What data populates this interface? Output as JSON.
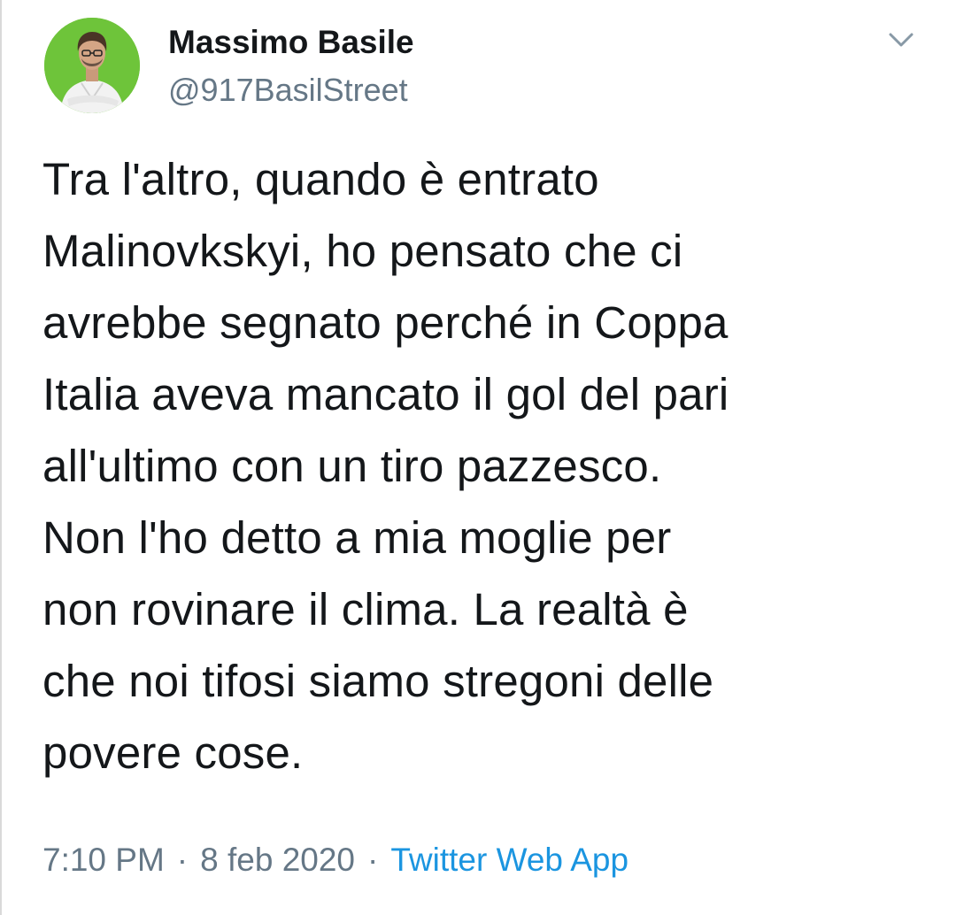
{
  "tweet": {
    "author": {
      "display_name": "Massimo Basile",
      "handle": "@917BasilStreet"
    },
    "text": "Tra l'altro, quando è entrato\nMalinovkskyi, ho pensato che ci\navrebbe segnato perché in Coppa\nItalia aveva mancato il gol del pari\nall'ultimo con un tiro pazzesco.\nNon l'ho detto a mia moglie per\nnon rovinare il clima. La realtà è\nche noi tifosi siamo stregoni delle\npovere cose.",
    "time": "7:10 PM",
    "date": "8 feb 2020",
    "separator": "·",
    "source": "Twitter Web App"
  },
  "icons": {
    "avatar": "profile-photo",
    "menu": "chevron-down-icon"
  },
  "colors": {
    "text": "#14171a",
    "secondary": "#657786",
    "link": "#1b95e0",
    "avatar_bg": "#6ec43a"
  }
}
